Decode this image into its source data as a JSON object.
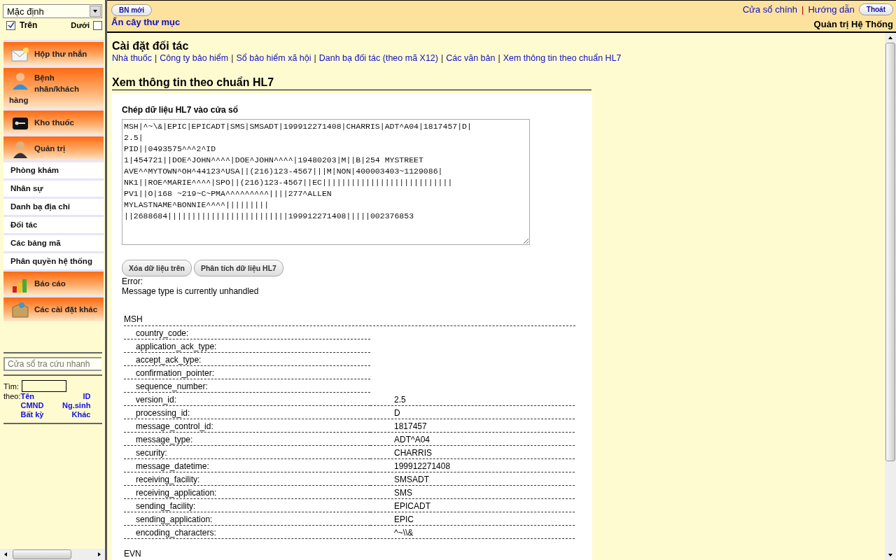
{
  "sidebar": {
    "profile_select": {
      "value": "Mặc định"
    },
    "position_checks": [
      {
        "label": "Trên",
        "checked": true
      },
      {
        "label": "Dưới",
        "checked": false
      }
    ],
    "menu": [
      {
        "label": "Hộp thư nhắn",
        "kind": "header"
      },
      {
        "label": "Bệnh nhân/khách hàng",
        "kind": "header"
      },
      {
        "label": "Kho thuốc",
        "kind": "header"
      },
      {
        "label": "Quản trị",
        "kind": "header"
      },
      {
        "label": "Phòng khám",
        "kind": "sub"
      },
      {
        "label": "Nhân sự",
        "kind": "sub"
      },
      {
        "label": "Danh bạ địa chỉ",
        "kind": "sub"
      },
      {
        "label": "Đối tác",
        "kind": "sub"
      },
      {
        "label": "Các bảng mã",
        "kind": "sub"
      },
      {
        "label": "Phân quyền hệ thống",
        "kind": "sub"
      },
      {
        "label": "Báo cáo",
        "kind": "header"
      },
      {
        "label": "Các cài đặt khác",
        "kind": "header"
      }
    ],
    "quick_search": {
      "placeholder": "Cửa sổ tra cứu nhanh"
    },
    "find_label": "Tìm:",
    "by_label": "theo:",
    "search_by": [
      [
        "Tên",
        "ID"
      ],
      [
        "CMND",
        "Ng.sinh"
      ],
      [
        "Bất kỳ",
        "Khác"
      ]
    ]
  },
  "header": {
    "new_patient_button": "BN mới",
    "hide_tree_link": "Ẩn cây thư mục",
    "links": [
      "Cửa sổ chính",
      "Hướng dẫn"
    ],
    "separator": "|",
    "exit_button": "Thoát",
    "user": "Quản trị Hệ Thống"
  },
  "page": {
    "title": "Cài đặt đối tác",
    "nav_links": [
      "Nhà thuốc",
      "Công ty bảo hiểm",
      "Sổ bảo hiểm xã hội",
      "Danh bạ đối tác (theo mã X12)",
      "Các văn bản",
      "Xem thông tin theo chuẩn HL7"
    ],
    "nav_separator": "|",
    "section_title": "Xem thông tin theo chuẩn HL7",
    "input_label": "Chép dữ liệu HL7 vào cửa sổ",
    "hl7_lines": [
      "MSH|^~\\&|EPIC|EPICADT|SMS|SMSADT|199912271408|CHARRIS|ADT^A04|1817457|D|",
      "2.5|",
      "PID||0493575^^^2^ID",
      "1|454721||DOE^JOHN^^^^|DOE^JOHN^^^^|19480203|M||B|254 MYSTREET",
      "AVE^^MYTOWN^OH^44123^USA||(216)123-4567|||M|NON|400003403~1129086|",
      "NK1||ROE^MARIE^^^^|SPO||(216)123-4567||EC|||||||||||||||||||||||||||",
      "PV1||O|168 ~219~C~PMA^^^^^^^^^||||277^ALLEN",
      "MYLASTNAME^BONNIE^^^^|||||||||",
      "||2688684|||||||||||||||||||||||||199912271408|||||002376853"
    ],
    "buttons": [
      "Xóa dữ liệu trên",
      "Phân tích dữ liệu HL7"
    ],
    "error_label": "Error:",
    "error_message": "Message type is currently unhandled",
    "segments": [
      {
        "name": "MSH",
        "fields": [
          {
            "name": "country_code:"
          },
          {
            "name": "application_ack_type:"
          },
          {
            "name": "accept_ack_type:"
          },
          {
            "name": "confirmation_pointer:"
          },
          {
            "name": "sequence_number:"
          },
          {
            "name": "version_id:",
            "value": "2.5"
          },
          {
            "name": "processing_id:",
            "value": "D"
          },
          {
            "name": "message_control_id:",
            "value": "1817457"
          },
          {
            "name": "message_type:",
            "value": "ADT^A04"
          },
          {
            "name": "security:",
            "value": "CHARRIS"
          },
          {
            "name": "message_datetime:",
            "value": "199912271408"
          },
          {
            "name": "receiving_facility:",
            "value": "SMSADT"
          },
          {
            "name": "receiving_application:",
            "value": "SMS"
          },
          {
            "name": "sending_facility:",
            "value": "EPICADT"
          },
          {
            "name": "sending_application:",
            "value": "EPIC"
          },
          {
            "name": "encoding_characters:",
            "value": "^~\\\\&"
          }
        ]
      },
      {
        "name": "EVN"
      }
    ]
  }
}
